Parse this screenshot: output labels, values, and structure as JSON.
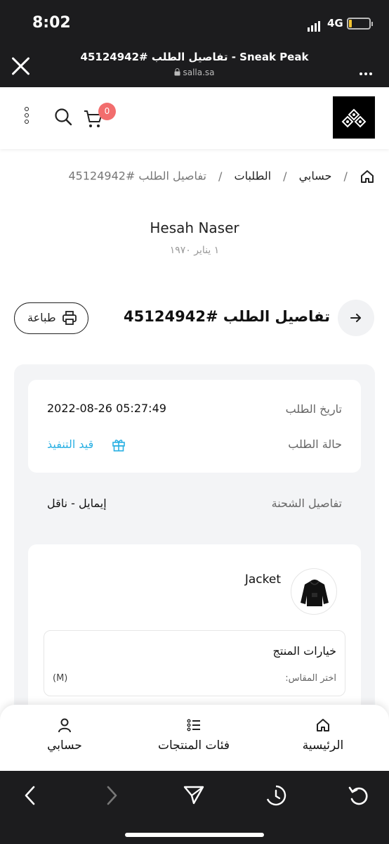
{
  "status_bar": {
    "time": "8:02",
    "network": "4G"
  },
  "browser": {
    "title": "تفاصيل الطلب #45124942 - Sneak Peak",
    "url": "salla.sa"
  },
  "header": {
    "cart_count": "0"
  },
  "breadcrumb": {
    "account": "حسابي",
    "orders": "الطلبات",
    "current": "تفاصيل الطلب #45124942",
    "separator": "/"
  },
  "customer": {
    "name": "Hesah Naser",
    "date": "١ يناير ١٩٧٠"
  },
  "order": {
    "title": "تفاصيل الطلب #45124942",
    "print_label": "طباعة",
    "date_label": "تاريخ الطلب",
    "date_value": "2022-08-26 05:27:49",
    "status_label": "حالة الطلب",
    "status_value": "قيد التنفيذ",
    "status_color": "#2ab0e3",
    "shipping_label": "تفاصيل الشحنة",
    "shipping_value": "إيمايل - ناقل"
  },
  "product": {
    "name": "Jacket",
    "options_title": "خيارات المنتج",
    "size_label": "اختر المقاس:",
    "size_value": "(M)"
  },
  "bottom_nav": {
    "home": "الرئيسية",
    "categories": "فئات المنتجات",
    "account": "حسابي"
  }
}
